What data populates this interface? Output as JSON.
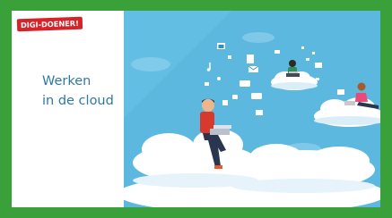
{
  "badge": {
    "label": "DIGI-DOENER!"
  },
  "title": {
    "line1": "Werken",
    "line2": "in de cloud"
  },
  "colors": {
    "frame": "#3aa13a",
    "sky": "#5db8e0",
    "title": "#2f79a0",
    "badge": "#d6232a"
  },
  "illustration": {
    "icons": [
      "music-note-icon",
      "envelope-icon",
      "chat-bubble-icon",
      "image-icon",
      "document-icon"
    ]
  }
}
